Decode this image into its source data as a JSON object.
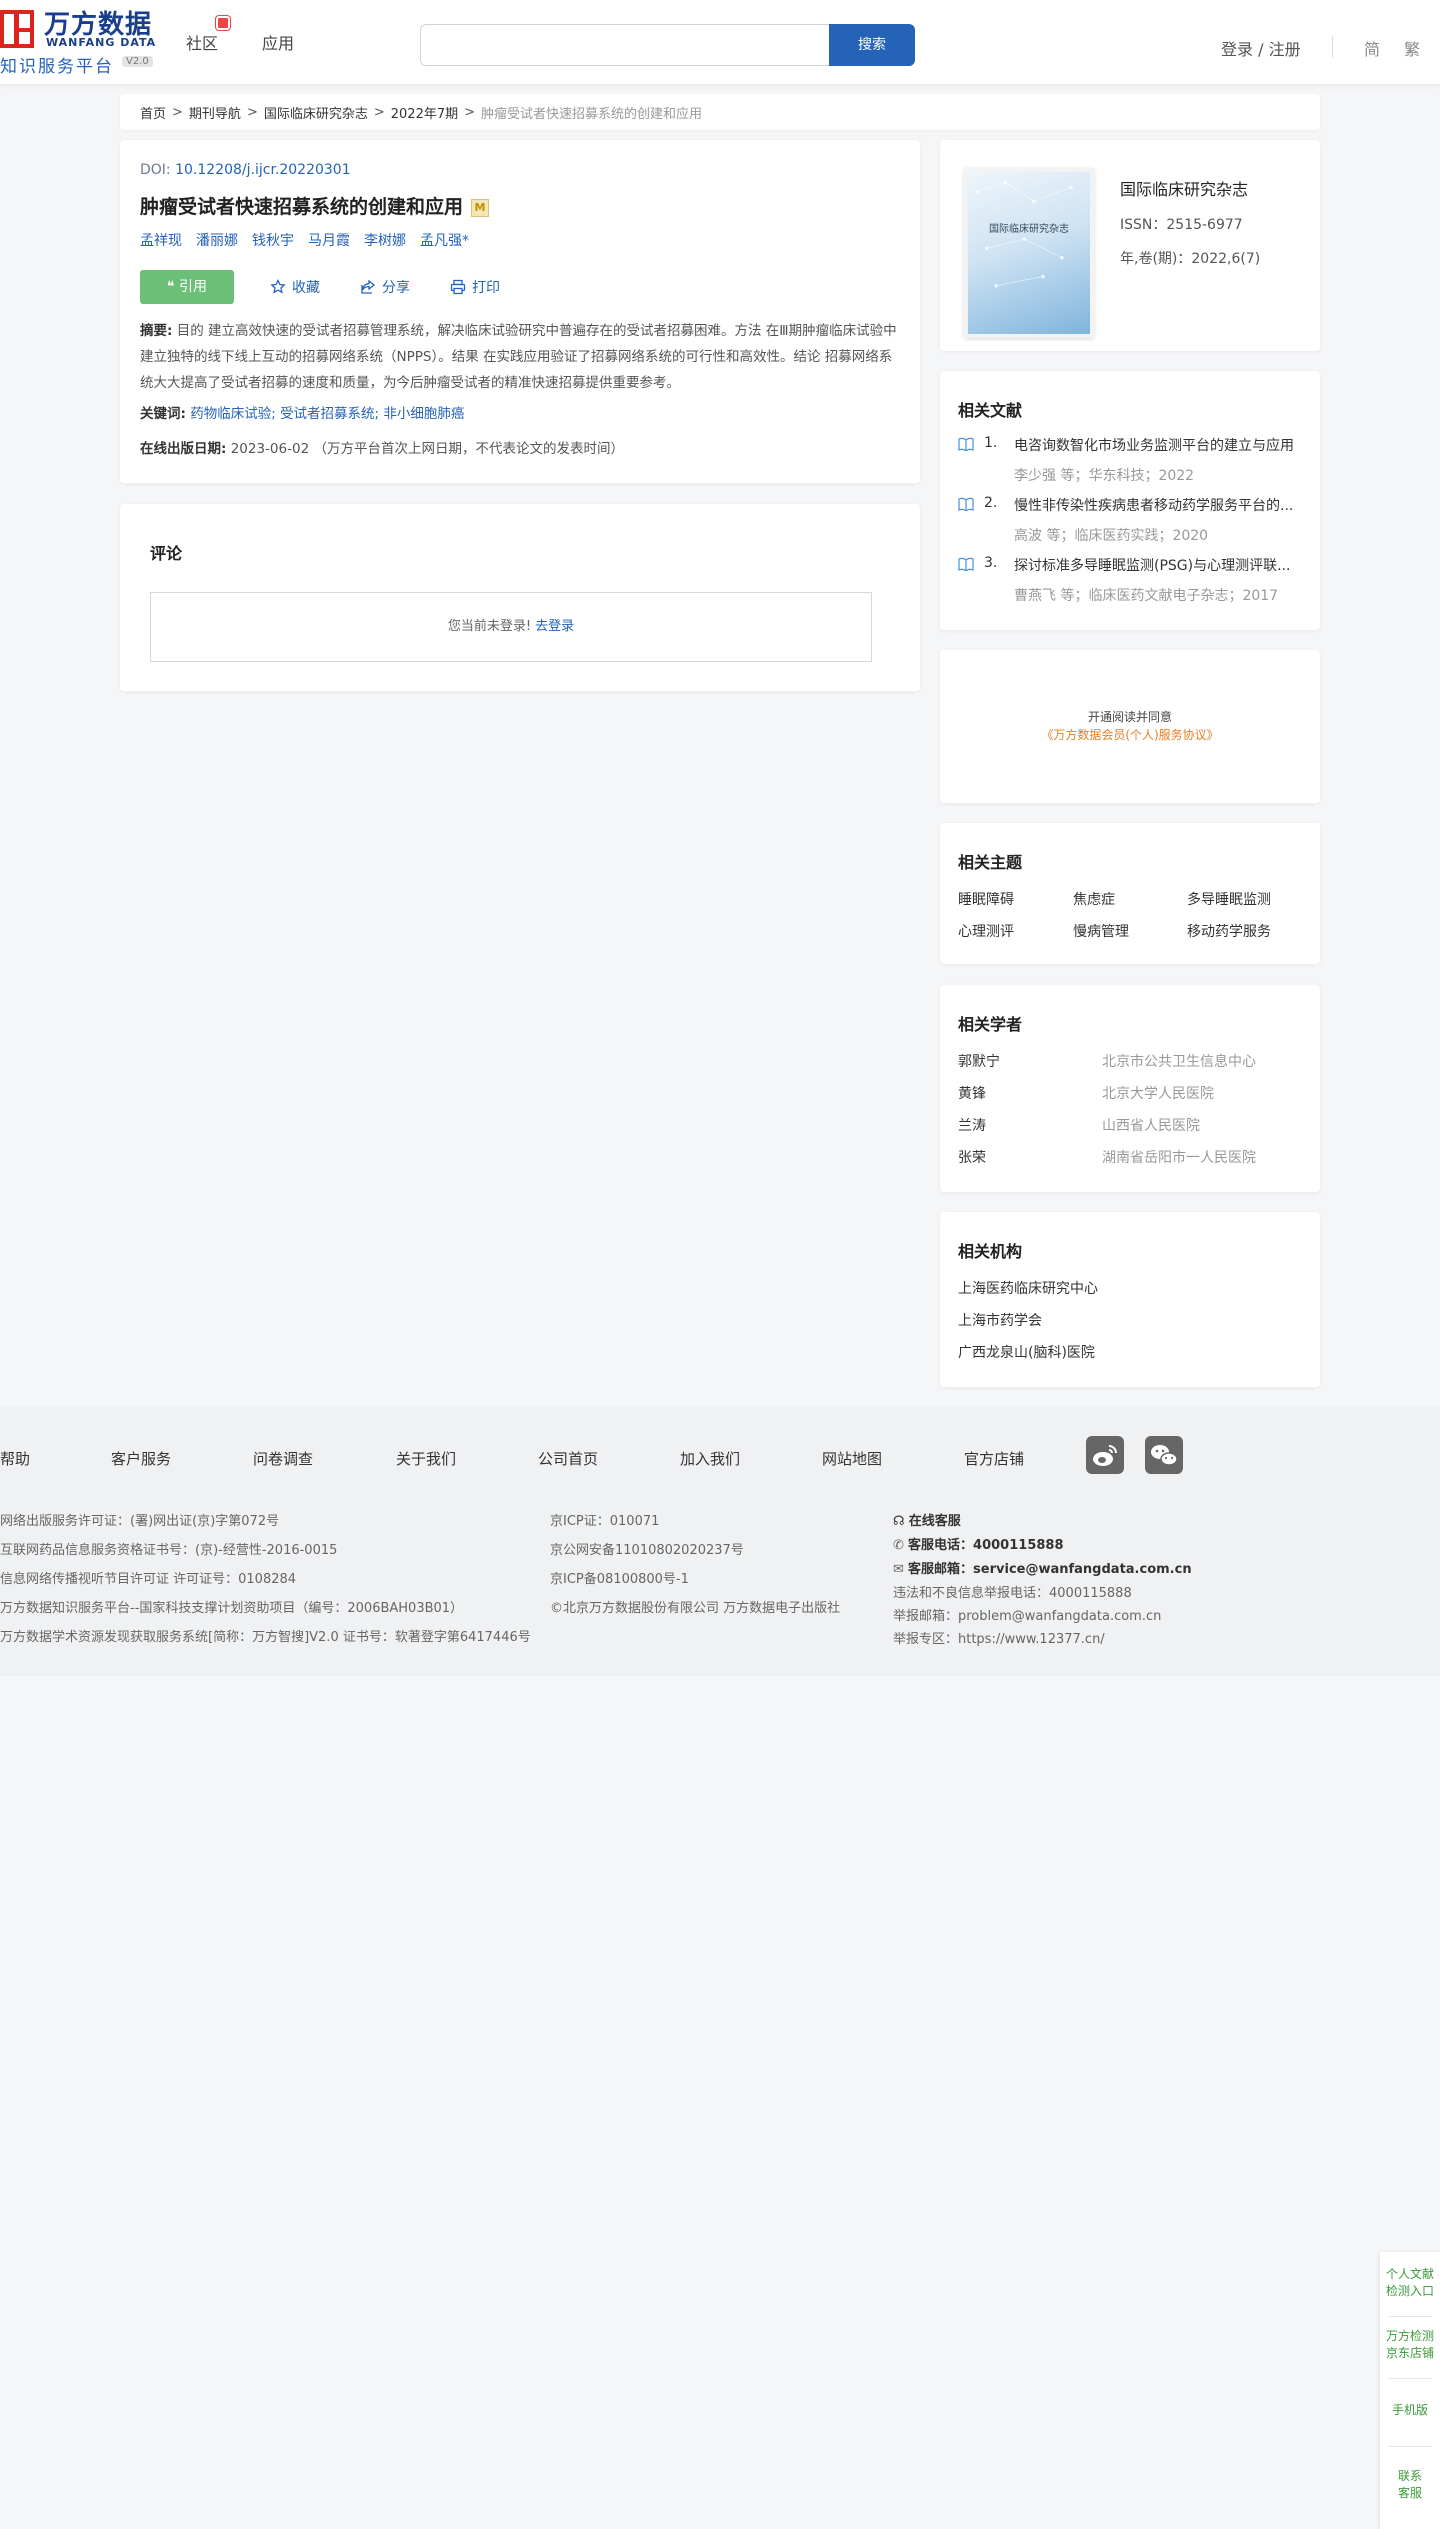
{
  "header": {
    "logo_cn": "万方数据",
    "logo_en": "WANFANG DATA",
    "logo_sub": "知识服务平台",
    "logo_version": "V2.0",
    "nav": [
      "社区",
      "应用"
    ],
    "search_placeholder": "",
    "search_button": "搜索",
    "login": "登录 / 注册",
    "lang_simplified": "简",
    "lang_traditional": "繁"
  },
  "breadcrumb": {
    "items": [
      "首页",
      "期刊导航",
      "国际临床研究杂志",
      "2022年7期"
    ],
    "current": "肿瘤受试者快速招募系统的创建和应用",
    "separator": ">"
  },
  "article": {
    "doi_label": "DOI:",
    "doi": "10.12208/j.ijcr.20220301",
    "title": "肿瘤受试者快速招募系统的创建和应用",
    "title_badge": "M",
    "authors": [
      "孟祥现",
      "潘丽娜",
      "钱秋宇",
      "马月霞",
      "李树娜",
      "孟凡强*"
    ],
    "actions": {
      "cite": "引用",
      "collect": "收藏",
      "share": "分享",
      "print": "打印"
    },
    "abstract_label": "摘要:",
    "abstract": "目的 建立高效快速的受试者招募管理系统，解决临床试验研究中普遍存在的受试者招募困难。方法 在Ⅲ期肿瘤临床试验中建立独特的线下线上互动的招募网络系统（NPPS）。结果 在实践应用验证了招募网络系统的可行性和高效性。结论 招募网络系统大大提高了受试者招募的速度和质量，为今后肿瘤受试者的精准快速招募提供重要参考。",
    "keywords_label": "关键词:",
    "keywords": [
      "药物临床试验;",
      "受试者招募系统;",
      "非小细胞肺癌"
    ],
    "pubdate_label": "在线出版日期:",
    "pubdate": "2023-06-02",
    "pubdate_note": "（万方平台首次上网日期，不代表论文的发表时间）"
  },
  "comment": {
    "title": "评论",
    "not_logged": "您当前未登录!",
    "login_link": "去登录"
  },
  "journal": {
    "cover_text": "国际临床研究杂志",
    "name": "国际临床研究杂志",
    "issn": "ISSN：2515-6977",
    "year_issue": "年,卷(期)：2022,6(7)"
  },
  "related_docs": {
    "title": "相关文献",
    "items": [
      {
        "num": "1.",
        "title": "电咨询数智化市场业务监测平台的建立与应用",
        "meta": "李少强  等；华东科技；2022"
      },
      {
        "num": "2.",
        "title": "慢性非传染性疾病患者移动药学服务平台的...",
        "meta": "高波  等；临床医药实践；2020"
      },
      {
        "num": "3.",
        "title": "探讨标准多导睡眠监测(PSG)与心理测评联...",
        "meta": "曹燕飞  等；临床医药文献电子杂志；2017"
      }
    ]
  },
  "promo": {
    "line1": "开通阅读并同意",
    "line2": "《万方数据会员(个人)服务协议》"
  },
  "topics": {
    "title": "相关主题",
    "items": [
      "睡眠障碍",
      "焦虑症",
      "多导睡眠监测",
      "心理测评",
      "慢病管理",
      "移动药学服务"
    ]
  },
  "scholars": {
    "title": "相关学者",
    "items": [
      {
        "name": "郭默宁",
        "org": "北京市公共卫生信息中心"
      },
      {
        "name": "黄锋",
        "org": "北京大学人民医院"
      },
      {
        "name": "兰涛",
        "org": "山西省人民医院"
      },
      {
        "name": "张荣",
        "org": "湖南省岳阳市一人民医院"
      }
    ]
  },
  "institutions": {
    "title": "相关机构",
    "items": [
      "上海医药临床研究中心",
      "上海市药学会",
      "广西龙泉山(脑科)医院"
    ]
  },
  "footer": {
    "links": [
      "帮助",
      "客户服务",
      "问卷调查",
      "关于我们",
      "公司首页",
      "加入我们",
      "网站地图",
      "官方店铺"
    ],
    "col1": [
      "网络出版服务许可证：(署)网出证(京)字第072号",
      "互联网药品信息服务资格证书号：(京)-经营性-2016-0015",
      "信息网络传播视听节目许可证 许可证号：0108284",
      "万方数据知识服务平台--国家科技支撑计划资助项目（编号：2006BAH03B01）",
      "万方数据学术资源发现获取服务系统[简称：万方智搜]V2.0 证书号：软著登字第6417446号"
    ],
    "col2": [
      "京ICP证：010071",
      "京公网安备11010802020237号",
      "京ICP备08100800号-1",
      "©北京万方数据股份有限公司 万方数据电子出版社"
    ],
    "online_service": "在线客服",
    "phone_label": "客服电话：",
    "phone": "4000115888",
    "email_label": "客服邮箱：",
    "email": "service@wanfangdata.com.cn",
    "report_phone": "违法和不良信息举报电话：4000115888",
    "report_email": "举报邮箱：problem@wanfangdata.com.cn",
    "report_zone": "举报专区：https://www.12377.cn/"
  },
  "float": {
    "items": [
      "个人文献检测入口",
      "万方检测京东店铺",
      "手机版",
      "联系客服"
    ]
  }
}
